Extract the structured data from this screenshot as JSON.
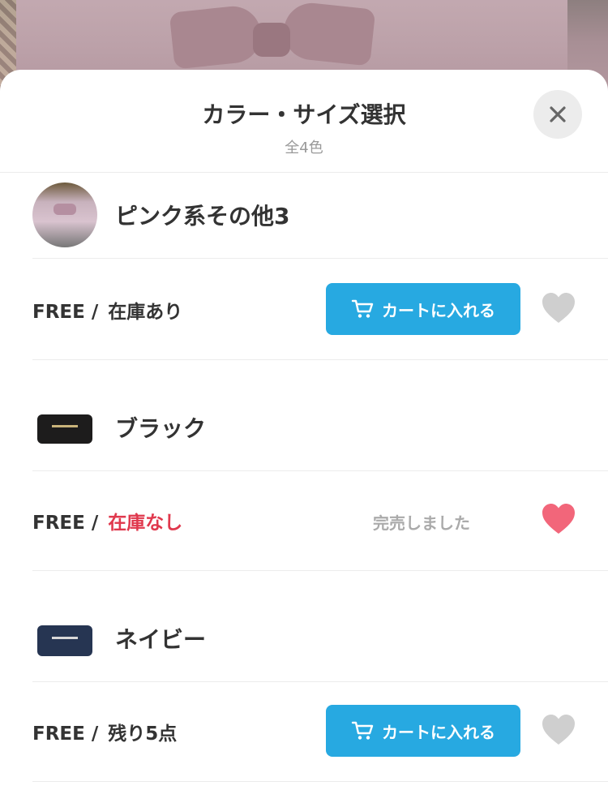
{
  "header": {
    "title": "カラー・サイズ選択",
    "subtitle": "全4色"
  },
  "colors": [
    {
      "name": "ピンク系その他3",
      "size": "FREE /",
      "stock": "在庫あり",
      "stock_status": "in-stock",
      "action": "カートに入れる",
      "favorited": false
    },
    {
      "name": "ブラック",
      "size": "FREE /",
      "stock": "在庫なし",
      "stock_status": "out-of-stock",
      "action": "完売しました",
      "favorited": true
    },
    {
      "name": "ネイビー",
      "size": "FREE /",
      "stock": "残り5点",
      "stock_status": "few-left",
      "action": "カートに入れる",
      "favorited": false
    }
  ],
  "theme": {
    "accent": "#27a9e1",
    "out_of_stock": "#e0384d",
    "heart_active": "#f2667a",
    "heart_inactive": "#cfcfcf"
  },
  "icons": [
    "close-icon",
    "cart-icon",
    "heart-icon"
  ]
}
